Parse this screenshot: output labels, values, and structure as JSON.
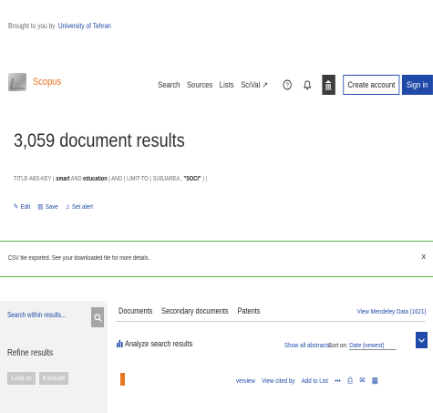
{
  "header": {
    "brought_prefix": "Brought to you by",
    "institution": "University of Tehran",
    "brand": "Scopus"
  },
  "topnav": {
    "links": [
      "Search",
      "Sources",
      "Lists",
      "SciVal ↗"
    ],
    "create_account": "Create account",
    "sign_in": "Sign in"
  },
  "results": {
    "title": "3,059 document results",
    "query": {
      "p1": "TITLE-ABS-KEY ( ",
      "smart": "smart",
      "p2": " AND ",
      "education": "education",
      "p3": " ) AND ( LIMIT-TO ( SUBJAREA , ",
      "soci": "\"SOCI\"",
      "p4": " ) )"
    },
    "actions": {
      "edit": "Edit",
      "save": "Save",
      "set_alert": "Set alert"
    }
  },
  "banner": {
    "message": "CSV file exported. See your downloaded file for more details.",
    "close": "x"
  },
  "sidebar": {
    "search_placeholder": "Search within results...",
    "refine_title": "Refine results",
    "limit_to": "Limit to",
    "exclude": "Exclude"
  },
  "tabs": [
    "Documents",
    "Secondary documents",
    "Patents"
  ],
  "mendeley": "View Mendeley Data (1621)",
  "analyze": "Analyze search results",
  "show_all_abstracts": "Show all abstracts",
  "sort": {
    "label": "Sort on:",
    "value": "Date (newest)"
  },
  "row_actions": {
    "overview": "verview",
    "cited_by": "View cited by",
    "add_to_list": "Add to List",
    "more": "•••"
  },
  "colors": {
    "brand_blue": "#1f4aa8",
    "scopus_orange": "#e9711c",
    "success_green": "#5fb54d"
  }
}
